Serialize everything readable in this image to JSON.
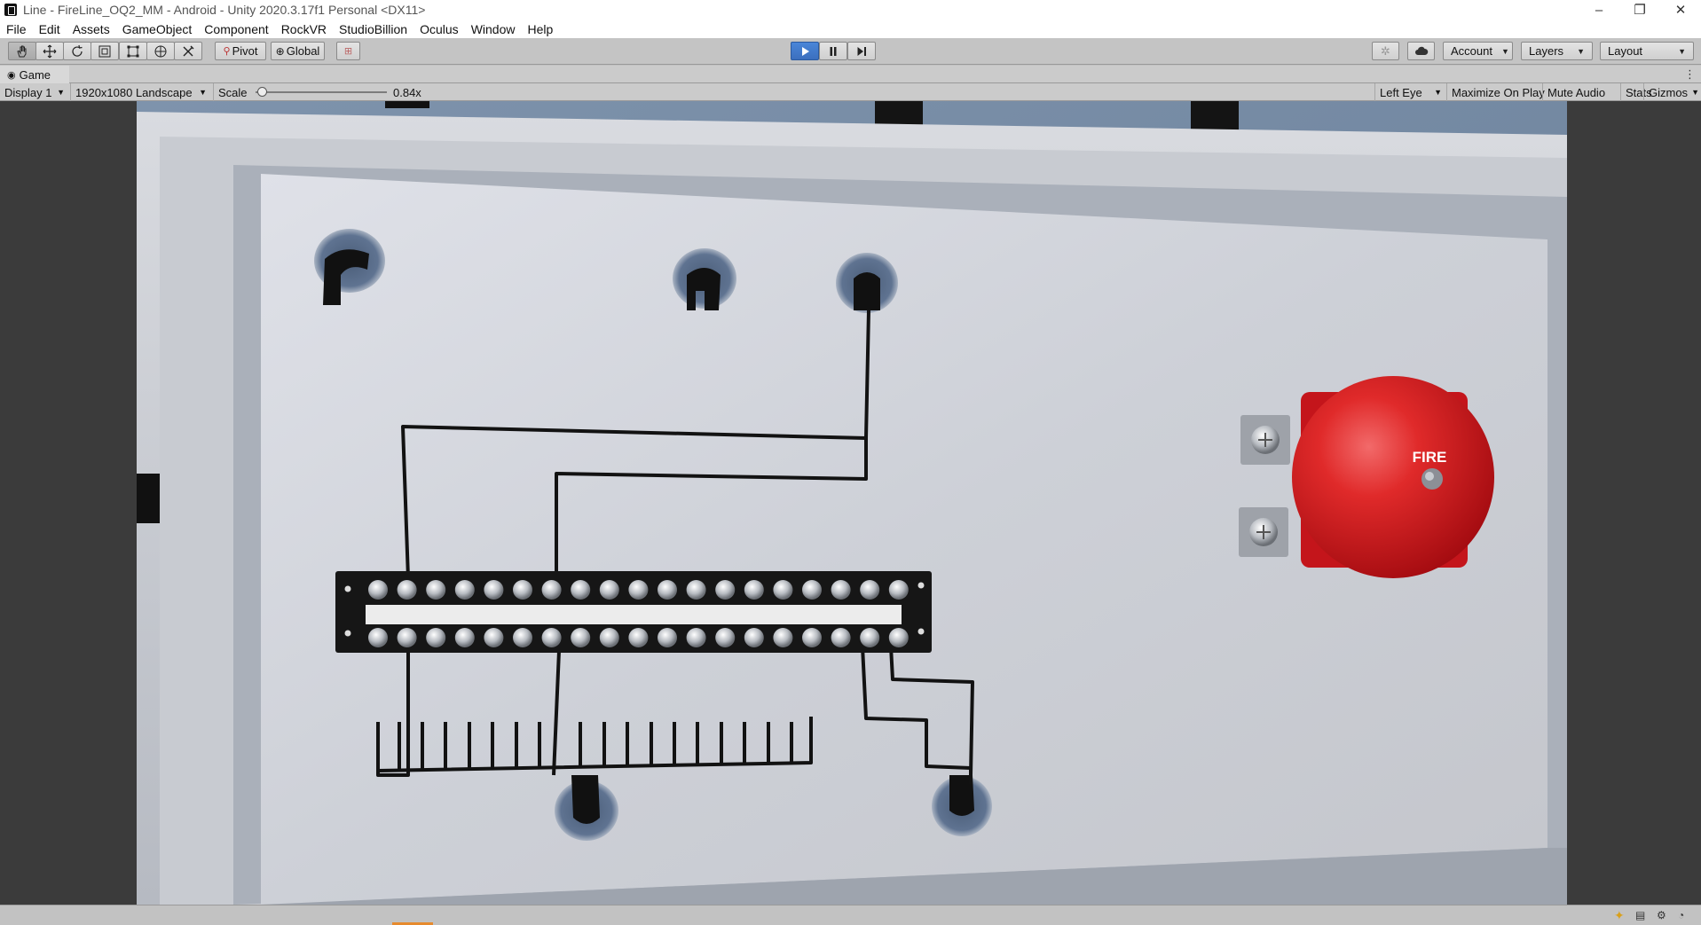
{
  "window": {
    "title": "Line - FireLine_OQ2_MM - Android - Unity 2020.3.17f1 Personal <DX11>",
    "minimize": "–",
    "restore": "❐",
    "close": "✕"
  },
  "menu": [
    "File",
    "Edit",
    "Assets",
    "GameObject",
    "Component",
    "RockVR",
    "StudioBillion",
    "Oculus",
    "Window",
    "Help"
  ],
  "toolbar": {
    "tools": [
      "hand-tool",
      "move-tool",
      "rotate-tool",
      "scale-tool",
      "rect-tool",
      "transform-tool",
      "custom-tool"
    ],
    "pivot_label": "Pivot",
    "global_label": "Global",
    "account_label": "Account",
    "layers_label": "Layers",
    "layout_label": "Layout"
  },
  "game_tab": {
    "label": "Game",
    "menu_dots": "⋮"
  },
  "game_toolbar": {
    "display": "Display 1",
    "resolution": "1920x1080 Landscape",
    "scale_label": "Scale",
    "scale_value": "0.84x",
    "scale_fraction": 0.05,
    "eye": "Left Eye",
    "maximize_on_play": "Maximize On Play",
    "mute_audio": "Mute Audio",
    "stats": "Stats",
    "gizmos": "Gizmos"
  },
  "scene": {
    "bell_label": "FIRE"
  },
  "colors": {
    "play_active": "#3b6fbe",
    "bell_red": "#d0161c",
    "panel": "#c9ccd2",
    "progress": "#e68a2e"
  }
}
